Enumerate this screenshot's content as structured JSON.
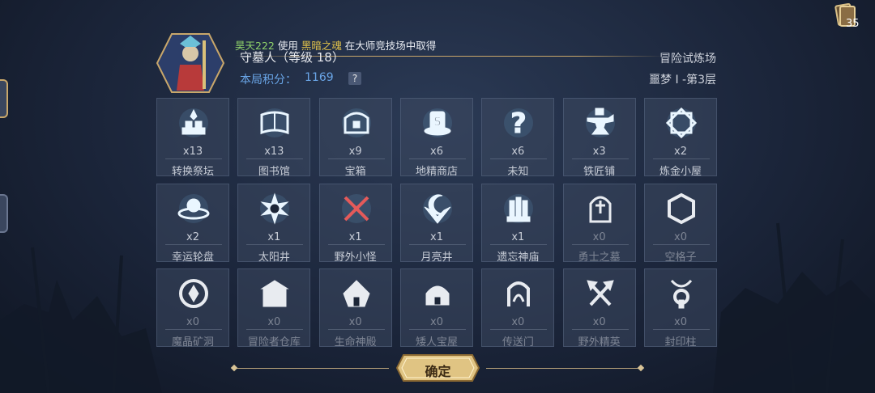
{
  "corner": {
    "count": "35",
    "icon": "card-deck-icon"
  },
  "player": {
    "name": "守墓人（等级 18）",
    "score_label": "本局积分：",
    "score_value": "1169",
    "help": "?"
  },
  "ticker": {
    "user": "昊天222",
    "verb": " 使用 ",
    "item": "黑暗之魂",
    "tail": " 在大师竞技场中取得"
  },
  "mode": {
    "name": "冒险试炼场",
    "stage": "噩梦 I -第3层"
  },
  "cells": [
    {
      "icon": "transform-altar-icon",
      "count": "x13",
      "name": "转换祭坛",
      "dim": false
    },
    {
      "icon": "library-book-icon",
      "count": "x13",
      "name": "图书馆",
      "dim": false
    },
    {
      "icon": "treasure-chest-icon",
      "count": "x9",
      "name": "宝箱",
      "dim": false
    },
    {
      "icon": "goblin-shop-icon",
      "count": "x6",
      "name": "地精商店",
      "dim": false
    },
    {
      "icon": "question-mark-icon",
      "count": "x6",
      "name": "未知",
      "dim": false
    },
    {
      "icon": "anvil-icon",
      "count": "x3",
      "name": "铁匠铺",
      "dim": false
    },
    {
      "icon": "alchemy-hut-icon",
      "count": "x2",
      "name": "炼金小屋",
      "dim": false
    },
    {
      "icon": "lucky-wheel-icon",
      "count": "x2",
      "name": "幸运轮盘",
      "dim": false
    },
    {
      "icon": "sun-well-icon",
      "count": "x1",
      "name": "太阳井",
      "dim": false
    },
    {
      "icon": "crossed-swords-icon",
      "count": "x1",
      "name": "野外小怪",
      "dim": false
    },
    {
      "icon": "moon-well-icon",
      "count": "x1",
      "name": "月亮井",
      "dim": false
    },
    {
      "icon": "forgotten-temple-icon",
      "count": "x1",
      "name": "遗忘神庙",
      "dim": false
    },
    {
      "icon": "tombstone-icon",
      "count": "x0",
      "name": "勇士之墓",
      "dim": true
    },
    {
      "icon": "hexagon-icon",
      "count": "x0",
      "name": "空格子",
      "dim": true
    },
    {
      "icon": "crystal-mine-icon",
      "count": "x0",
      "name": "魔晶矿洞",
      "dim": true
    },
    {
      "icon": "warehouse-icon",
      "count": "x0",
      "name": "冒险者仓库",
      "dim": true
    },
    {
      "icon": "life-temple-icon",
      "count": "x0",
      "name": "生命神殿",
      "dim": true
    },
    {
      "icon": "dwarf-house-icon",
      "count": "x0",
      "name": "矮人宝屋",
      "dim": true
    },
    {
      "icon": "portal-icon",
      "count": "x0",
      "name": "传送门",
      "dim": true
    },
    {
      "icon": "crossed-axes-icon",
      "count": "x0",
      "name": "野外精英",
      "dim": true
    },
    {
      "icon": "seal-pillar-icon",
      "count": "x0",
      "name": "封印柱",
      "dim": true
    }
  ],
  "confirm": {
    "label": "确定"
  },
  "colors": {
    "accent_blue": "#6aa6e8",
    "gold": "#c9a76a",
    "icon": "#eaf6ff",
    "icon_glow": "#7fd0ff"
  }
}
